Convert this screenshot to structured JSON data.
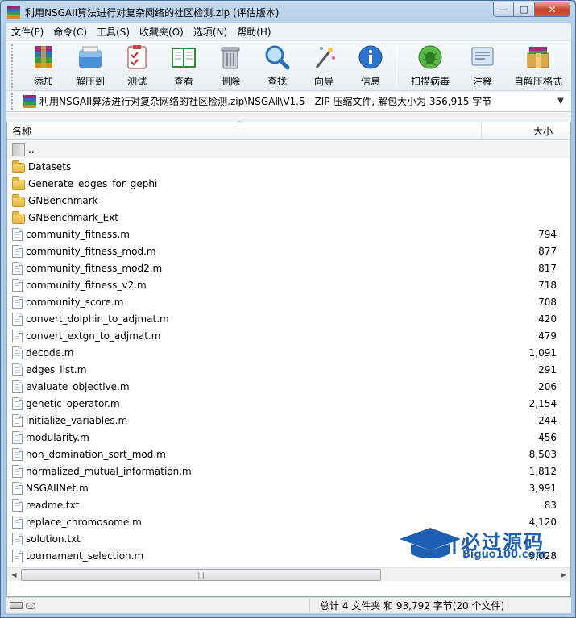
{
  "window": {
    "title": "利用NSGAII算法进行对复杂网络的社区检测.zip (评估版本)",
    "controls": {
      "minimize": "—",
      "maximize": "□",
      "close": "✕"
    }
  },
  "menu": [
    "文件(F)",
    "命令(C)",
    "工具(S)",
    "收藏夹(O)",
    "选项(N)",
    "帮助(H)"
  ],
  "toolbar": [
    {
      "label": "添加",
      "icon": "add-archive-icon"
    },
    {
      "label": "解压到",
      "icon": "extract-to-icon"
    },
    {
      "label": "测试",
      "icon": "test-icon"
    },
    {
      "label": "查看",
      "icon": "view-book-icon"
    },
    {
      "label": "删除",
      "icon": "trash-icon"
    },
    {
      "label": "查找",
      "icon": "find-magnifier-icon"
    },
    {
      "label": "向导",
      "icon": "wizard-wand-icon"
    },
    {
      "label": "信息",
      "icon": "info-icon"
    },
    {
      "label": "扫描病毒",
      "icon": "virus-scan-icon"
    },
    {
      "label": "注释",
      "icon": "comment-icon"
    },
    {
      "label": "自解压格式",
      "icon": "sfx-box-icon"
    }
  ],
  "address": {
    "text": "利用NSGAII算法进行对复杂网络的社区检测.zip\\NSGAⅡ\\V1.5 - ZIP 压缩文件, 解包大小为 356,915 字节",
    "dropdown": "▼"
  },
  "columns": {
    "name": "名称",
    "size": "大小",
    "sort_indicator": "^"
  },
  "rows": [
    {
      "name": "..",
      "size": "",
      "type": "up"
    },
    {
      "name": "Datasets",
      "size": "",
      "type": "folder"
    },
    {
      "name": "Generate_edges_for_gephi",
      "size": "",
      "type": "folder"
    },
    {
      "name": "GNBenchmark",
      "size": "",
      "type": "folder"
    },
    {
      "name": "GNBenchmark_Ext",
      "size": "",
      "type": "folder"
    },
    {
      "name": "community_fitness.m",
      "size": "794",
      "type": "file"
    },
    {
      "name": "community_fitness_mod.m",
      "size": "877",
      "type": "file"
    },
    {
      "name": "community_fitness_mod2.m",
      "size": "817",
      "type": "file"
    },
    {
      "name": "community_fitness_v2.m",
      "size": "718",
      "type": "file"
    },
    {
      "name": "community_score.m",
      "size": "708",
      "type": "file"
    },
    {
      "name": "convert_dolphin_to_adjmat.m",
      "size": "420",
      "type": "file"
    },
    {
      "name": "convert_extgn_to_adjmat.m",
      "size": "479",
      "type": "file"
    },
    {
      "name": "decode.m",
      "size": "1,091",
      "type": "file"
    },
    {
      "name": "edges_list.m",
      "size": "291",
      "type": "file"
    },
    {
      "name": "evaluate_objective.m",
      "size": "206",
      "type": "file"
    },
    {
      "name": "genetic_operator.m",
      "size": "2,154",
      "type": "file"
    },
    {
      "name": "initialize_variables.m",
      "size": "244",
      "type": "file"
    },
    {
      "name": "modularity.m",
      "size": "456",
      "type": "file"
    },
    {
      "name": "non_domination_sort_mod.m",
      "size": "8,503",
      "type": "file"
    },
    {
      "name": "normalized_mutual_information.m",
      "size": "1,812",
      "type": "file"
    },
    {
      "name": "NSGAIINet.m",
      "size": "3,991",
      "type": "file"
    },
    {
      "name": "readme.txt",
      "size": "83",
      "type": "file"
    },
    {
      "name": "replace_chromosome.m",
      "size": "4,120",
      "type": "file"
    },
    {
      "name": "solution.txt",
      "size": "",
      "type": "file"
    },
    {
      "name": "tournament_selection.m",
      "size": "5,028",
      "type": "file"
    }
  ],
  "scrollbar": {
    "left": "◀",
    "right": "▶",
    "thumb_grip": "|||"
  },
  "status": {
    "summary": "总计 4 文件夹 和 93,792 字节(20 个文件)"
  },
  "watermark": {
    "cn": "必过源码",
    "en": "Biguo100.com"
  }
}
